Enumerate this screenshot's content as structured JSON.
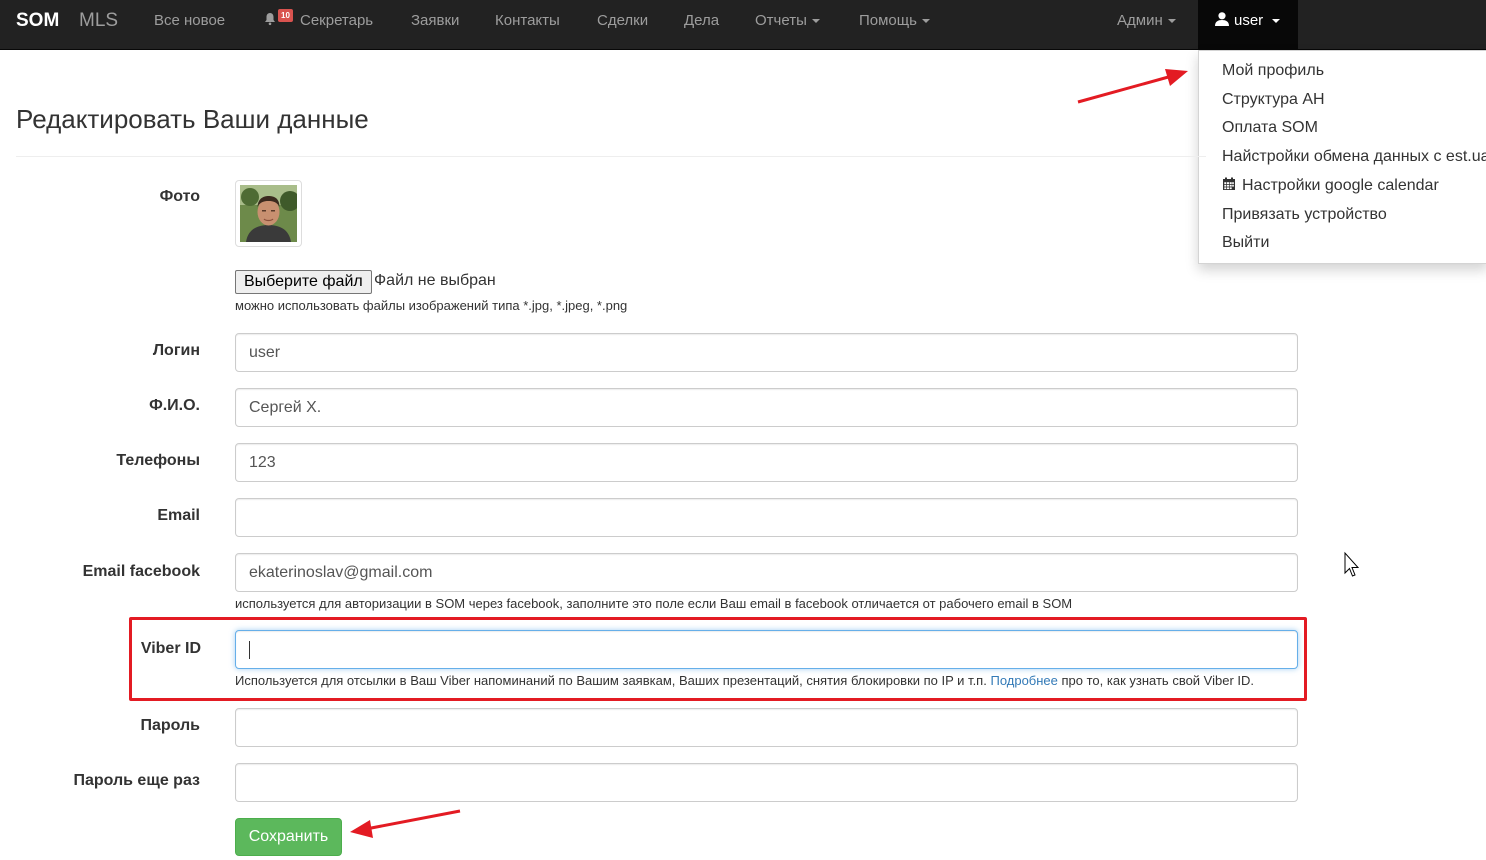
{
  "navbar": {
    "brand": "SOM",
    "brand_secondary": "MLS",
    "items": [
      {
        "label": "Все новое"
      },
      {
        "label": "Секретарь",
        "badge": "10"
      },
      {
        "label": "Заявки"
      },
      {
        "label": "Контакты"
      },
      {
        "label": "Сделки"
      },
      {
        "label": "Дела"
      },
      {
        "label": "Отчеты"
      },
      {
        "label": "Помощь"
      }
    ],
    "admin": "Админ",
    "user": "user"
  },
  "user_menu": {
    "items": [
      {
        "label": "Мой профиль"
      },
      {
        "label": "Структура АН"
      },
      {
        "label": "Оплата SOM"
      },
      {
        "label": "Найстройки обмена данных с est.ua"
      },
      {
        "label": "Настройки google calendar",
        "icon": "calendar-icon"
      },
      {
        "label": "Привязать устройство"
      },
      {
        "label": "Выйти"
      }
    ]
  },
  "page": {
    "title": "Редактировать Ваши данные"
  },
  "form": {
    "photo_label": "Фото",
    "file_button": "Выберите файл",
    "file_status": "Файл не выбран",
    "file_help": "можно использовать файлы изображений типа *.jpg, *.jpeg, *.png",
    "login_label": "Логин",
    "login_value": "user",
    "fio_label": "Ф.И.О.",
    "fio_value": "Сергей Х.",
    "phones_label": "Телефоны",
    "phones_value": "123",
    "email_label": "Email",
    "email_value": "",
    "fb_label": "Email facebook",
    "fb_value": "ekaterinoslav@gmail.com",
    "fb_help": "используется для авторизации в SOM через facebook, заполните это поле если Ваш email в facebook отличается от рабочего email в SOM",
    "viber_label": "Viber ID",
    "viber_value": "",
    "viber_help_before": "Используется для отсылки в Ваш Viber напоминаний по Вашим заявкам, Ваших презентаций, снятия блокировки по IP и т.п.",
    "viber_help_link": "Подробнее",
    "viber_help_after": "про то, как узнать свой Viber ID.",
    "password_label": "Пароль",
    "password_again_label": "Пароль еще раз",
    "save_button": "Сохранить"
  },
  "colors": {
    "navbar_bg": "#222222",
    "save_green": "#5cb85c",
    "annotation_red": "#e31b23",
    "link_blue": "#337ab7"
  }
}
